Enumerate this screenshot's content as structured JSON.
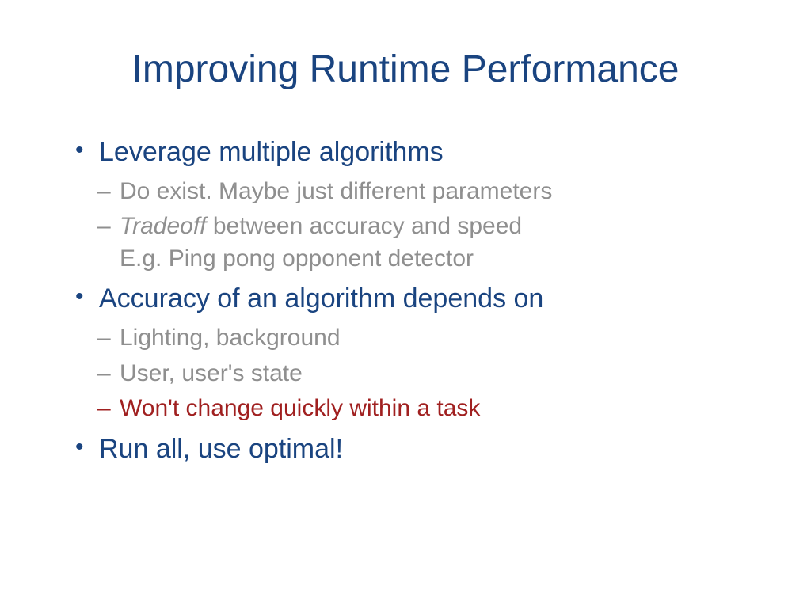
{
  "title": "Improving Runtime Performance",
  "bullets": {
    "b1": "Leverage multiple algorithms",
    "b1_sub1": "Do exist. Maybe just different parameters",
    "b1_sub2_italic": "Tradeoff",
    "b1_sub2_rest": " between accuracy and speed",
    "b1_sub2_line2": "E.g. Ping pong opponent detector",
    "b2": "Accuracy of an algorithm depends on",
    "b2_sub1": "Lighting, background",
    "b2_sub2": "User, user's state",
    "b2_sub3": "Won't change quickly within a task",
    "b3": "Run all, use optimal!"
  }
}
